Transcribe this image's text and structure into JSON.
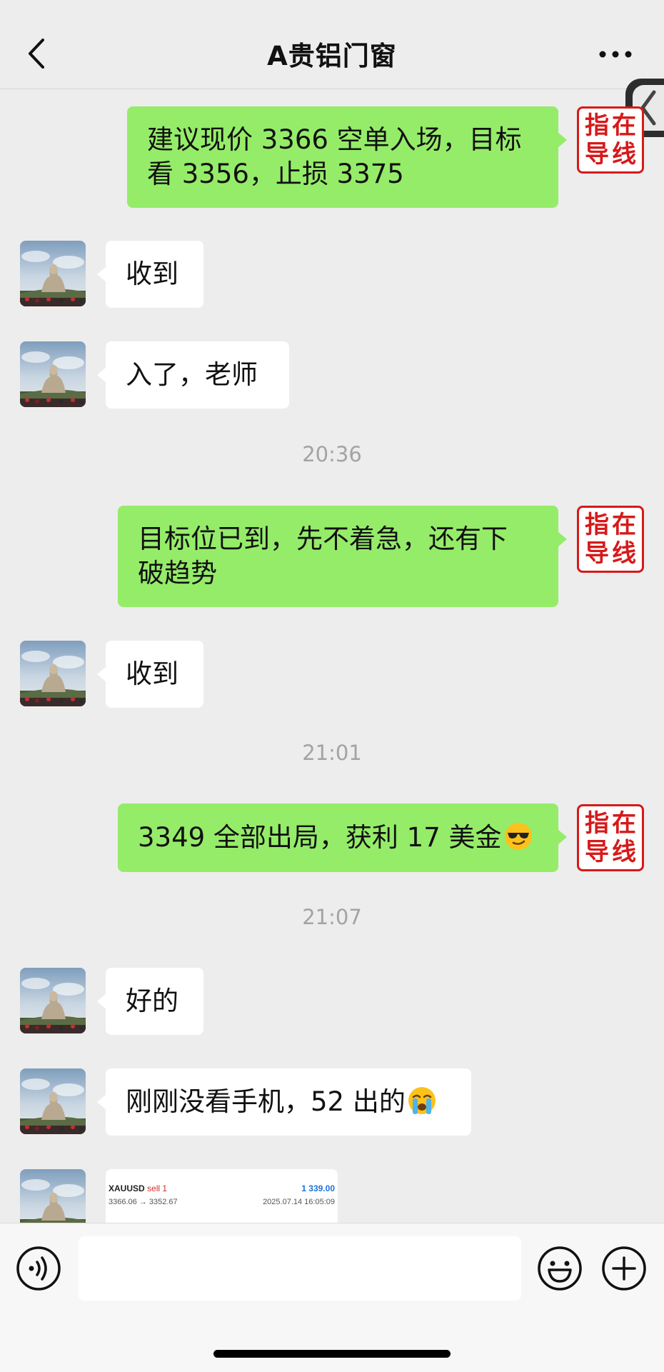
{
  "header": {
    "title": "A贵铝门窗",
    "back_icon": "chevron-left-icon",
    "more_icon": "more-horizontal-icon"
  },
  "teacher_avatar": {
    "chars": [
      "指",
      "在",
      "导",
      "线"
    ],
    "color": "#d61a1a"
  },
  "messages": [
    {
      "type": "out",
      "text_lines": [
        "建议现价 3366 空单入场，目标",
        "看 3356，止损 3375"
      ]
    },
    {
      "type": "in",
      "text": "收到"
    },
    {
      "type": "in",
      "text": "入了，老师"
    },
    {
      "type": "time",
      "text": "20:36"
    },
    {
      "type": "out",
      "text_lines": [
        "目标位已到，先不着急，还有下",
        "破趋势"
      ]
    },
    {
      "type": "in",
      "text": "收到"
    },
    {
      "type": "time",
      "text": "21:01"
    },
    {
      "type": "out",
      "text": "3349 全部出局，获利 17 美金",
      "emoji": "smiling-face-with-sunglasses"
    },
    {
      "type": "time",
      "text": "21:07"
    },
    {
      "type": "in",
      "text": "好的"
    },
    {
      "type": "in",
      "text": "刚刚没看手机，52 出的",
      "emoji": "loudly-crying-face"
    },
    {
      "type": "in-card",
      "symbol": "XAUUSD",
      "direction": "sell 1",
      "profit": "1 339.00",
      "prices": "3366.06 → 3352.67",
      "time": "2025.07.14 16:05:09"
    }
  ],
  "input_bar": {
    "voice_icon": "voice-icon",
    "emoji_icon": "emoji-icon",
    "plus_icon": "plus-icon",
    "placeholder": ""
  },
  "colors": {
    "outgoing_bubble": "#95ec69",
    "incoming_bubble": "#ffffff",
    "background": "#ededed"
  }
}
